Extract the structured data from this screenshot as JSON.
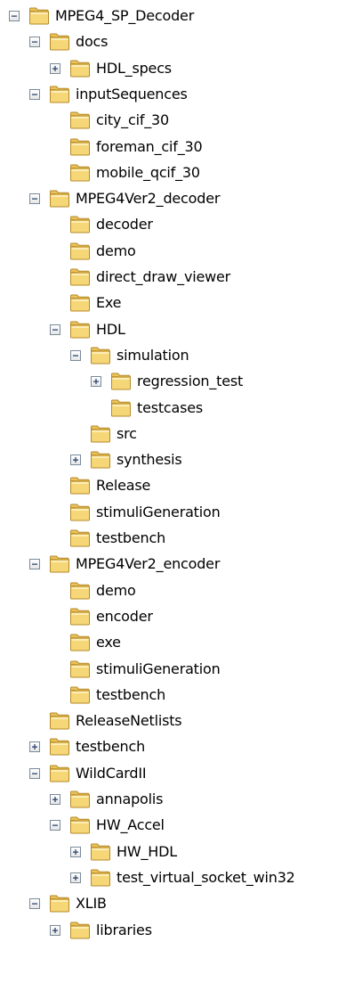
{
  "tree": [
    {
      "label": "MPEG4_SP_Decoder",
      "depth": 0,
      "toggle": "collapse"
    },
    {
      "label": "docs",
      "depth": 1,
      "toggle": "collapse"
    },
    {
      "label": "HDL_specs",
      "depth": 2,
      "toggle": "expand"
    },
    {
      "label": "inputSequences",
      "depth": 1,
      "toggle": "collapse"
    },
    {
      "label": "city_cif_30",
      "depth": 2,
      "toggle": "none"
    },
    {
      "label": "foreman_cif_30",
      "depth": 2,
      "toggle": "none"
    },
    {
      "label": "mobile_qcif_30",
      "depth": 2,
      "toggle": "none"
    },
    {
      "label": "MPEG4Ver2_decoder",
      "depth": 1,
      "toggle": "collapse"
    },
    {
      "label": "decoder",
      "depth": 2,
      "toggle": "none"
    },
    {
      "label": "demo",
      "depth": 2,
      "toggle": "none"
    },
    {
      "label": "direct_draw_viewer",
      "depth": 2,
      "toggle": "none"
    },
    {
      "label": "Exe",
      "depth": 2,
      "toggle": "none"
    },
    {
      "label": "HDL",
      "depth": 2,
      "toggle": "collapse"
    },
    {
      "label": "simulation",
      "depth": 3,
      "toggle": "collapse"
    },
    {
      "label": "regression_test",
      "depth": 4,
      "toggle": "expand"
    },
    {
      "label": "testcases",
      "depth": 4,
      "toggle": "none"
    },
    {
      "label": "src",
      "depth": 3,
      "toggle": "none"
    },
    {
      "label": "synthesis",
      "depth": 3,
      "toggle": "expand"
    },
    {
      "label": "Release",
      "depth": 2,
      "toggle": "none"
    },
    {
      "label": "stimuliGeneration",
      "depth": 2,
      "toggle": "none"
    },
    {
      "label": "testbench",
      "depth": 2,
      "toggle": "none"
    },
    {
      "label": "MPEG4Ver2_encoder",
      "depth": 1,
      "toggle": "collapse"
    },
    {
      "label": "demo",
      "depth": 2,
      "toggle": "none"
    },
    {
      "label": "encoder",
      "depth": 2,
      "toggle": "none"
    },
    {
      "label": "exe",
      "depth": 2,
      "toggle": "none"
    },
    {
      "label": "stimuliGeneration",
      "depth": 2,
      "toggle": "none"
    },
    {
      "label": "testbench",
      "depth": 2,
      "toggle": "none"
    },
    {
      "label": "ReleaseNetlists",
      "depth": 1,
      "toggle": "none"
    },
    {
      "label": "testbench",
      "depth": 1,
      "toggle": "expand"
    },
    {
      "label": "WildCardII",
      "depth": 1,
      "toggle": "collapse"
    },
    {
      "label": "annapolis",
      "depth": 2,
      "toggle": "expand"
    },
    {
      "label": "HW_Accel",
      "depth": 2,
      "toggle": "collapse"
    },
    {
      "label": "HW_HDL",
      "depth": 3,
      "toggle": "expand"
    },
    {
      "label": "test_virtual_socket_win32",
      "depth": 3,
      "toggle": "expand"
    },
    {
      "label": "XLIB",
      "depth": 1,
      "toggle": "collapse"
    },
    {
      "label": "libraries",
      "depth": 2,
      "toggle": "expand"
    }
  ],
  "colors": {
    "folder_body": "#f6d778",
    "folder_tab": "#eac35a",
    "folder_outline": "#b58a2a",
    "expander_border": "#7a8a99"
  },
  "icons": {
    "folder": "folder-icon",
    "expand": "plus-box-icon",
    "collapse": "minus-box-icon"
  }
}
